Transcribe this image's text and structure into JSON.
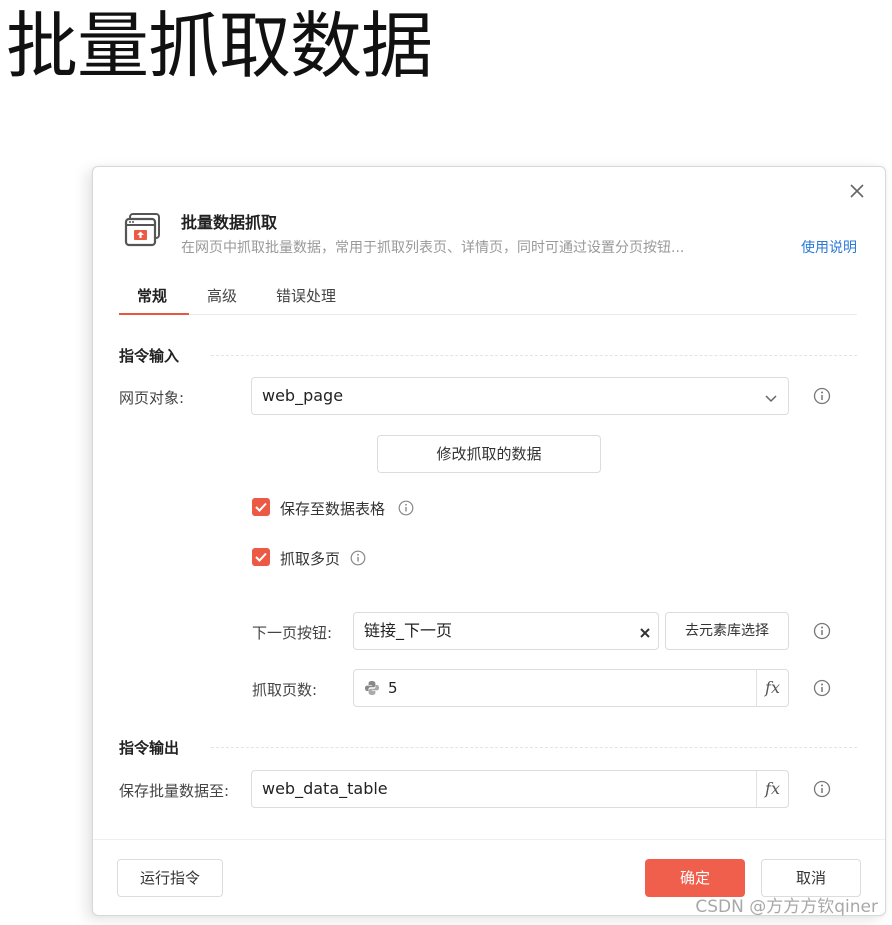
{
  "page": {
    "heading": "批量抓取数据",
    "watermark": "CSDN @方方方钦qiner"
  },
  "dialog": {
    "title": "批量数据抓取",
    "description": "在网页中抓取批量数据，常用于抓取列表页、详情页，同时可通过设置分页按钮...",
    "help_link": "使用说明",
    "tabs": [
      "常规",
      "高级",
      "错误处理"
    ],
    "active_tab": "常规",
    "input_section": {
      "title": "指令输入",
      "web_object": {
        "label": "网页对象:",
        "value": "web_page"
      },
      "modify_button": "修改抓取的数据",
      "save_to_table": {
        "label": "保存至数据表格",
        "checked": true
      },
      "multi_page": {
        "label": "抓取多页",
        "checked": true
      },
      "next_button": {
        "label": "下一页按钮:",
        "value": "链接_下一页",
        "select_button": "去元素库选择"
      },
      "page_count": {
        "label": "抓取页数:",
        "value": "5"
      }
    },
    "output_section": {
      "title": "指令输出",
      "save_to": {
        "label": "保存批量数据至:",
        "value": "web_data_table"
      }
    },
    "footer": {
      "run_button": "运行指令",
      "confirm_button": "确定",
      "cancel_button": "取消"
    },
    "fx_label": "fx",
    "icons": {
      "header": "browser-window-icon",
      "close": "close-icon",
      "info": "info-icon",
      "dropdown": "chevron-down-icon",
      "clear": "clear-x-icon",
      "python": "python-icon"
    },
    "colors": {
      "accent": "#e8573f",
      "primary_button": "#f05f4c",
      "link": "#2b7ad6"
    }
  }
}
